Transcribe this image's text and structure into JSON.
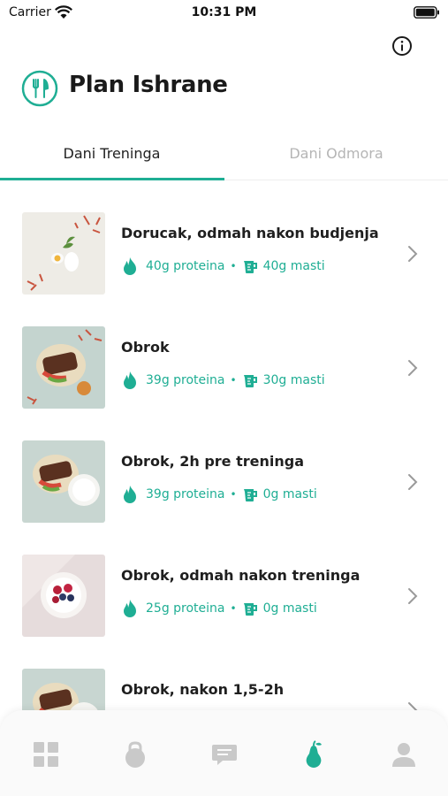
{
  "status_bar": {
    "carrier": "Carrier",
    "time": "10:31 PM"
  },
  "header": {
    "title": "Plan Ishrane"
  },
  "tabs": [
    {
      "label": "Dani Treninga",
      "active": true
    },
    {
      "label": "Dani Odmora",
      "active": false
    }
  ],
  "meals": [
    {
      "name": "Dorucak, odmah nakon budjenja",
      "protein": "40g proteina",
      "fat": "40g masti",
      "image": "egg-plate"
    },
    {
      "name": "Obrok",
      "protein": "39g proteina",
      "fat": "30g masti",
      "image": "steak-plate"
    },
    {
      "name": "Obrok, 2h pre treninga",
      "protein": "39g proteina",
      "fat": "0g masti",
      "image": "steak-rice-plate"
    },
    {
      "name": "Obrok, odmah nakon treninga",
      "protein": "25g proteina",
      "fat": "0g masti",
      "image": "berry-yogurt"
    },
    {
      "name": "Obrok, nakon 1,5-2h",
      "protein": "",
      "fat": "",
      "image": "steak-rice-plate"
    }
  ],
  "bottom_nav": [
    {
      "icon": "grid-icon",
      "active": false
    },
    {
      "icon": "kettlebell-icon",
      "active": false
    },
    {
      "icon": "chat-icon",
      "active": false
    },
    {
      "icon": "pear-icon",
      "active": true
    },
    {
      "icon": "person-icon",
      "active": false
    }
  ],
  "colors": {
    "accent": "#1fae94",
    "inactive_icon": "#c9c9c9",
    "text": "#1f1f1f"
  }
}
